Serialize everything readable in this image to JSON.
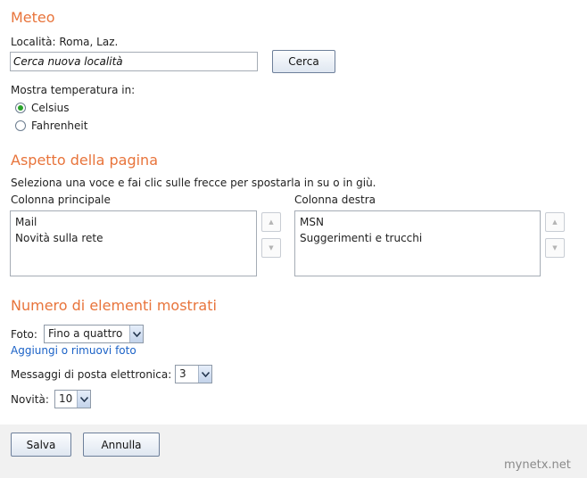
{
  "weather": {
    "title": "Meteo",
    "location_label": "Località: Roma, Laz.",
    "search_value": "Cerca nuova località",
    "search_button": "Cerca",
    "temperature_label": "Mostra temperatura in:",
    "options": [
      {
        "label": "Celsius",
        "selected": true
      },
      {
        "label": "Fahrenheit",
        "selected": false
      }
    ]
  },
  "layout": {
    "title": "Aspetto della pagina",
    "instructions": "Seleziona una voce e fai clic sulle frecce per spostarla in su o in giù.",
    "main_column": {
      "label": "Colonna principale",
      "items": [
        "Mail",
        "Novità sulla rete"
      ]
    },
    "right_column": {
      "label": "Colonna destra",
      "items": [
        "MSN",
        "Suggerimenti e trucchi"
      ]
    },
    "up_arrow": "▲",
    "down_arrow": "▼"
  },
  "counts": {
    "title": "Numero di elementi mostrati",
    "photos_label": "Foto:",
    "photos_value": "Fino a quattro",
    "photos_link": "Aggiungi o rimuovi foto",
    "email_label": "Messaggi di posta elettronica:",
    "email_value": "3",
    "news_label": "Novità:",
    "news_value": "10"
  },
  "actions": {
    "save": "Salva",
    "cancel": "Annulla"
  },
  "watermark": "mynetx.net",
  "colors": {
    "heading": "#e8743b",
    "link": "#1b62c7",
    "radio_selected": "#29a329"
  }
}
